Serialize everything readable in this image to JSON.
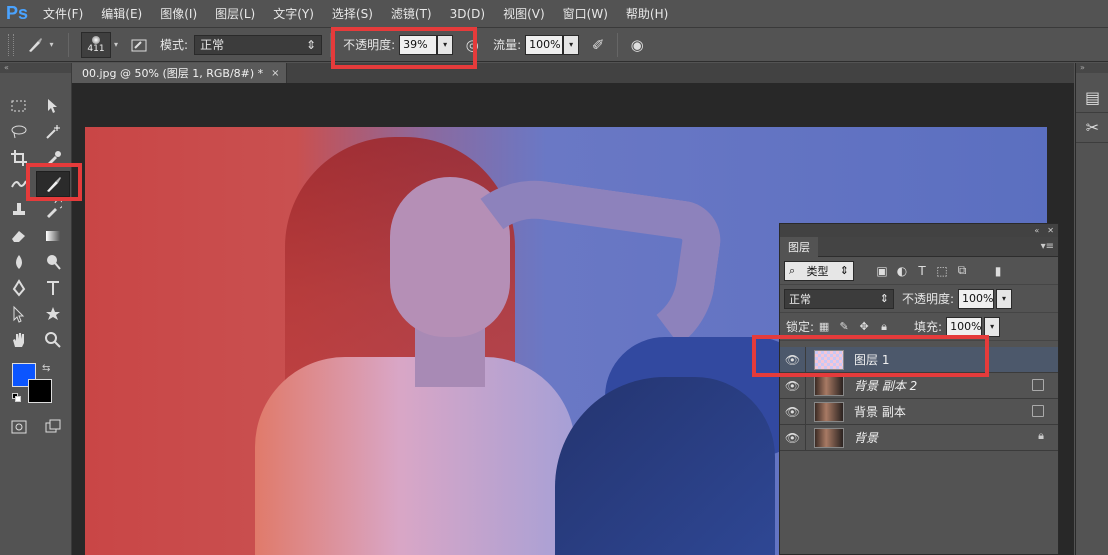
{
  "app": {
    "logo": "Ps"
  },
  "menu": [
    "文件(F)",
    "编辑(E)",
    "图像(I)",
    "图层(L)",
    "文字(Y)",
    "选择(S)",
    "滤镜(T)",
    "3D(D)",
    "视图(V)",
    "窗口(W)",
    "帮助(H)"
  ],
  "options": {
    "brush_size": "411",
    "mode_label": "模式:",
    "mode_value": "正常",
    "opacity_label": "不透明度:",
    "opacity_value": "39%",
    "flow_label": "流量:",
    "flow_value": "100%"
  },
  "document": {
    "tab_title": "00.jpg @ 50% (图层 1, RGB/8#) *",
    "close": "×"
  },
  "colors": {
    "foreground": "#0b55ff",
    "background": "#000000",
    "highlight": "#e53b3b"
  },
  "layers_panel": {
    "tab": "图层",
    "filter_type": "类型",
    "blend_mode": "正常",
    "opacity_label": "不透明度:",
    "opacity_value": "100%",
    "lock_label": "锁定:",
    "fill_label": "填充:",
    "fill_value": "100%",
    "layers": [
      {
        "name": "图层 1",
        "selected": true,
        "thumb": "checker"
      },
      {
        "name": "背景 副本 2",
        "selected": false,
        "thumb": "photo"
      },
      {
        "name": "背景 副本",
        "selected": false,
        "thumb": "photo"
      },
      {
        "name": "背景",
        "selected": false,
        "thumb": "photo",
        "locked": true
      }
    ]
  }
}
